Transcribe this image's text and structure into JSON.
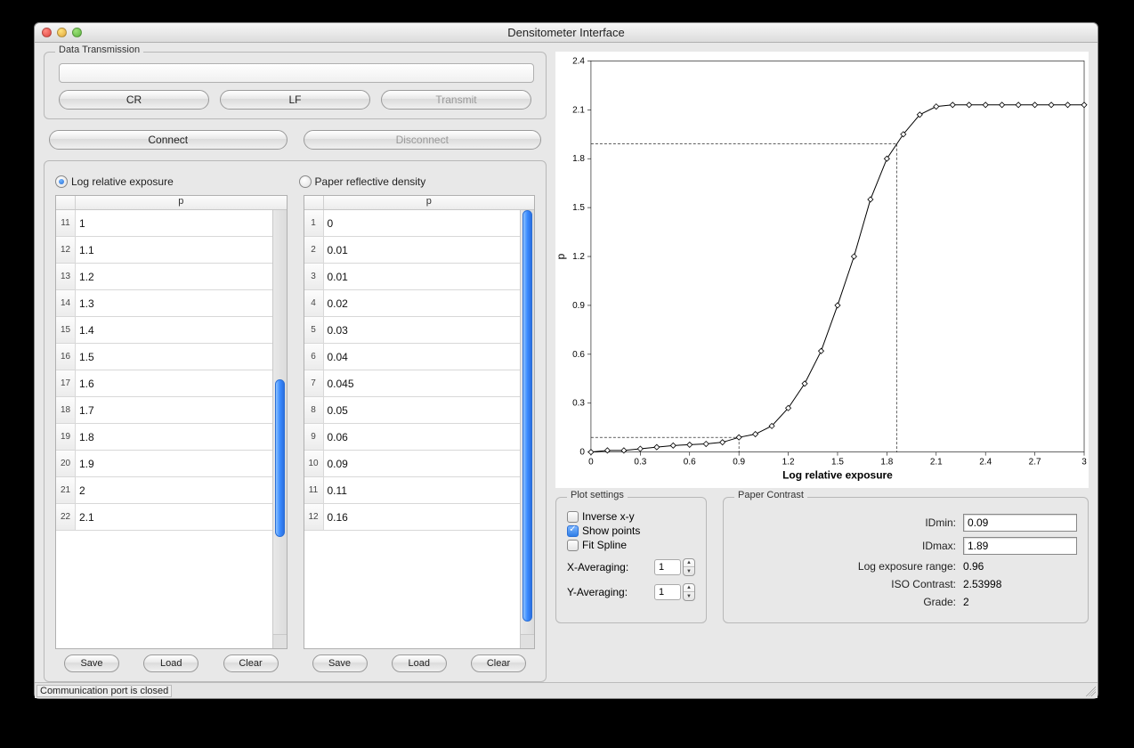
{
  "window": {
    "title": "Densitometer Interface"
  },
  "transmission": {
    "group_label": "Data Transmission",
    "input_value": "",
    "cr": "CR",
    "lf": "LF",
    "transmit": "Transmit"
  },
  "connection": {
    "connect": "Connect",
    "disconnect": "Disconnect"
  },
  "radios": {
    "log_exp": "Log relative exposure",
    "paper_refl": "Paper reflective density",
    "selected": "log_exp"
  },
  "table_header": "p",
  "left_table": {
    "rows": [
      {
        "n": "11",
        "v": "1"
      },
      {
        "n": "12",
        "v": "1.1"
      },
      {
        "n": "13",
        "v": "1.2"
      },
      {
        "n": "14",
        "v": "1.3"
      },
      {
        "n": "15",
        "v": "1.4"
      },
      {
        "n": "16",
        "v": "1.5"
      },
      {
        "n": "17",
        "v": "1.6"
      },
      {
        "n": "18",
        "v": "1.7"
      },
      {
        "n": "19",
        "v": "1.8"
      },
      {
        "n": "20",
        "v": "1.9"
      },
      {
        "n": "21",
        "v": "2"
      },
      {
        "n": "22",
        "v": "2.1"
      }
    ]
  },
  "right_table": {
    "rows": [
      {
        "n": "1",
        "v": "0"
      },
      {
        "n": "2",
        "v": "0.01"
      },
      {
        "n": "3",
        "v": "0.01"
      },
      {
        "n": "4",
        "v": "0.02"
      },
      {
        "n": "5",
        "v": "0.03"
      },
      {
        "n": "6",
        "v": "0.04"
      },
      {
        "n": "7",
        "v": "0.045"
      },
      {
        "n": "8",
        "v": "0.05"
      },
      {
        "n": "9",
        "v": "0.06"
      },
      {
        "n": "10",
        "v": "0.09"
      },
      {
        "n": "11",
        "v": "0.11"
      },
      {
        "n": "12",
        "v": "0.16"
      }
    ]
  },
  "table_buttons": {
    "save": "Save",
    "load": "Load",
    "clear": "Clear"
  },
  "plot_settings": {
    "group_label": "Plot settings",
    "inverse_xy": "Inverse x-y",
    "show_points": "Show points",
    "fit_spline": "Fit Spline",
    "inverse_xy_checked": false,
    "show_points_checked": true,
    "fit_spline_checked": false,
    "x_avg_label": "X-Averaging:",
    "y_avg_label": "Y-Averaging:",
    "x_avg": "1",
    "y_avg": "1"
  },
  "paper_contrast": {
    "group_label": "Paper Contrast",
    "idmin_label": "IDmin:",
    "idmax_label": "IDmax:",
    "idmin": "0.09",
    "idmax": "1.89",
    "range_label": "Log exposure range:",
    "range": "0.96",
    "iso_label": "ISO Contrast:",
    "iso": "2.53998",
    "grade_label": "Grade:",
    "grade": "2"
  },
  "status": "Communication port is closed",
  "chart_data": {
    "type": "line",
    "title": "",
    "xlabel": "Log relative exposure",
    "ylabel": "p",
    "xlim": [
      0,
      3
    ],
    "ylim": [
      0,
      2.4
    ],
    "x_ticks": [
      0,
      0.3,
      0.6,
      0.9,
      1.2,
      1.5,
      1.8,
      2.1,
      2.4,
      2.7,
      3
    ],
    "y_ticks": [
      0,
      0.3,
      0.6,
      0.9,
      1.2,
      1.5,
      1.8,
      2.1,
      2.4
    ],
    "x": [
      0,
      0.1,
      0.2,
      0.3,
      0.4,
      0.5,
      0.6,
      0.7,
      0.8,
      0.9,
      1.0,
      1.1,
      1.2,
      1.3,
      1.4,
      1.5,
      1.6,
      1.7,
      1.8,
      1.9,
      2.0,
      2.1,
      2.2,
      2.3,
      2.4,
      2.5,
      2.6,
      2.7,
      2.8,
      2.9,
      3.0
    ],
    "y": [
      0,
      0.01,
      0.01,
      0.02,
      0.03,
      0.04,
      0.045,
      0.05,
      0.06,
      0.09,
      0.11,
      0.16,
      0.27,
      0.42,
      0.62,
      0.9,
      1.2,
      1.55,
      1.8,
      1.95,
      2.07,
      2.12,
      2.13,
      2.13,
      2.13,
      2.13,
      2.13,
      2.13,
      2.13,
      2.13,
      2.13
    ],
    "ref_lines": {
      "v1_x": 0.9,
      "v2_x": 1.86,
      "h1_y": 0.09,
      "h2_y": 1.89
    }
  }
}
